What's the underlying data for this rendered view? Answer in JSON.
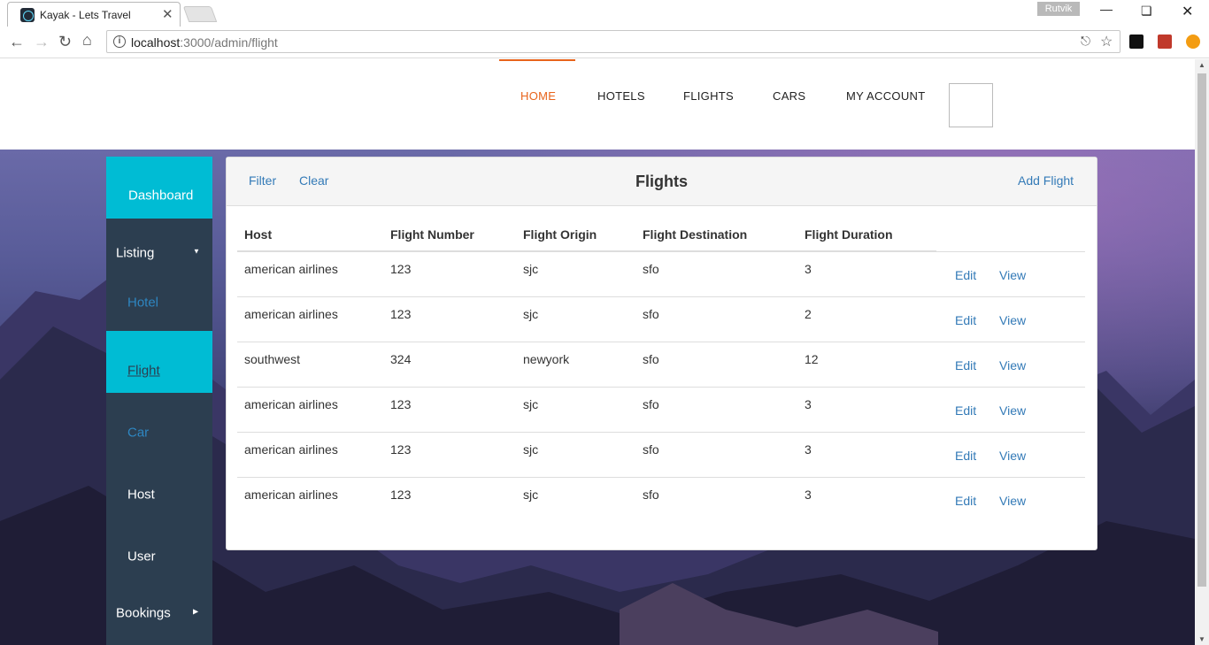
{
  "browser": {
    "tab_title": "Kayak - Lets Travel",
    "tab_close": "✕",
    "profile": "Rutvik",
    "url_host": "localhost",
    "url_rest": ":3000/admin/flight"
  },
  "header": {
    "nav": [
      "HOME",
      "HOTELS",
      "FLIGHTS",
      "CARS",
      "MY ACCOUNT"
    ],
    "active_nav": "HOME",
    "accent_color": "#e8641b"
  },
  "sidebar": {
    "items": [
      {
        "label": "Dashboard"
      },
      {
        "label": "Listing"
      },
      {
        "label": "Hotel"
      },
      {
        "label": "Flight"
      },
      {
        "label": "Car"
      },
      {
        "label": "Host"
      },
      {
        "label": "User"
      },
      {
        "label": "Bookings"
      }
    ],
    "accent_color": "#00bcd4",
    "bg_color": "#2c3e50"
  },
  "panel": {
    "filter": "Filter",
    "clear": "Clear",
    "title": "Flights",
    "add": "Add Flight"
  },
  "table": {
    "columns": [
      "Host",
      "Flight Number",
      "Flight Origin",
      "Flight Destination",
      "Flight Duration"
    ],
    "rows": [
      {
        "host": "american airlines",
        "number": "123",
        "origin": "sjc",
        "destination": "sfo",
        "duration": "3"
      },
      {
        "host": "american airlines",
        "number": "123",
        "origin": "sjc",
        "destination": "sfo",
        "duration": "2"
      },
      {
        "host": "southwest",
        "number": "324",
        "origin": "newyork",
        "destination": "sfo",
        "duration": "12"
      },
      {
        "host": "american airlines",
        "number": "123",
        "origin": "sjc",
        "destination": "sfo",
        "duration": "3"
      },
      {
        "host": "american airlines",
        "number": "123",
        "origin": "sjc",
        "destination": "sfo",
        "duration": "3"
      },
      {
        "host": "american airlines",
        "number": "123",
        "origin": "sjc",
        "destination": "sfo",
        "duration": "3"
      }
    ],
    "edit_label": "Edit",
    "view_label": "View"
  }
}
